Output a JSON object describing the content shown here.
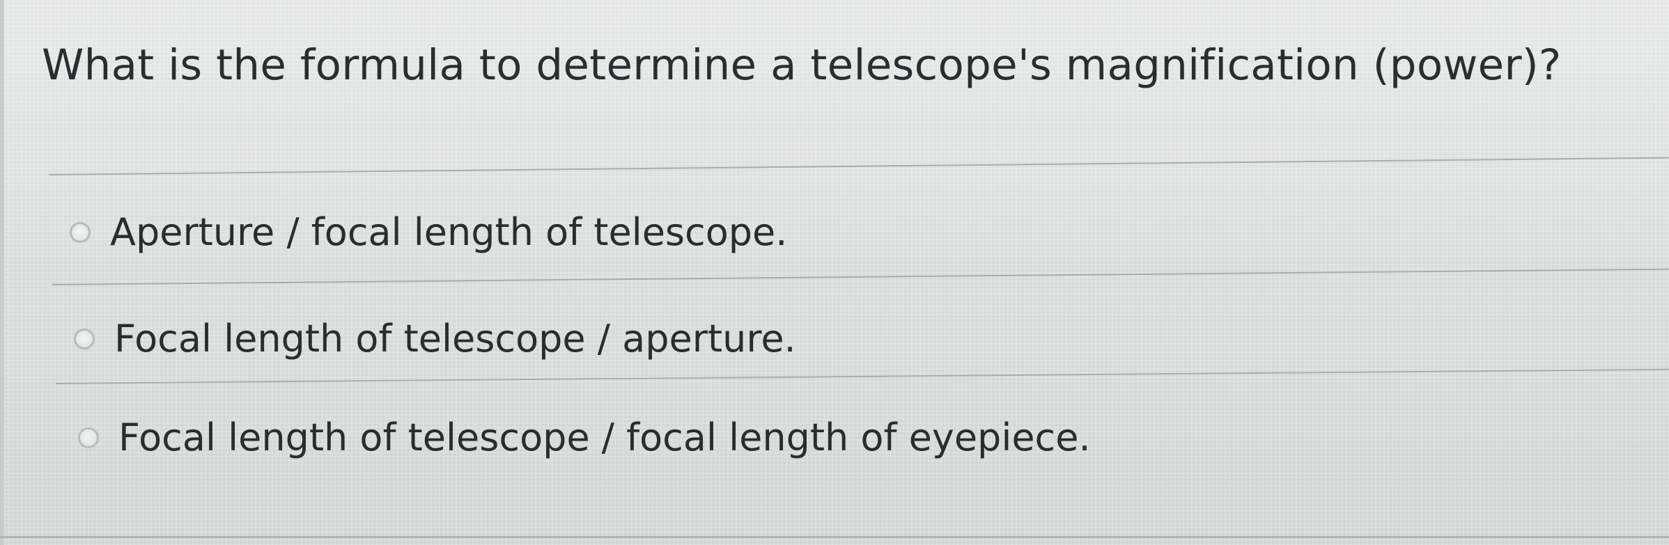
{
  "question": {
    "text": "What is the formula to determine a telescope's magnification (power)?"
  },
  "options": [
    {
      "label": "Aperture / focal length of telescope.",
      "selected": false
    },
    {
      "label": "Focal length of telescope / aperture.",
      "selected": false
    },
    {
      "label": "Focal length of telescope / focal length of eyepiece.",
      "selected": false
    }
  ]
}
